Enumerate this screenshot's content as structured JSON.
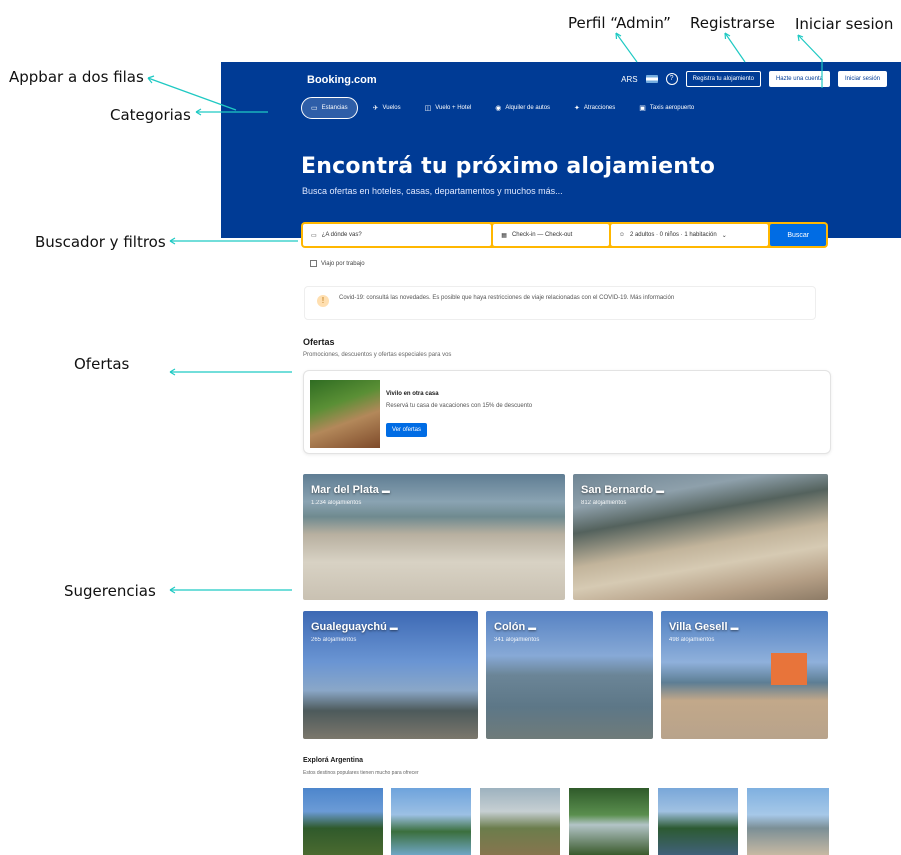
{
  "annotations": {
    "admin_profile": "Perfil “Admin”",
    "register": "Registrarse",
    "login": "Iniciar sesion",
    "appbar": "Appbar a dos filas",
    "categories": "Categorias",
    "search_filters": "Buscador y filtros",
    "offers": "Ofertas",
    "suggestions": "Sugerencias"
  },
  "appbar": {
    "logo": "Booking.com",
    "currency": "ARS",
    "admin_button": "Registra tu alojamiento",
    "register_button": "Hazte una cuenta",
    "login_button": "Iniciar sesión"
  },
  "categories": [
    {
      "label": "Estancias",
      "icon": "bed-icon"
    },
    {
      "label": "Vuelos",
      "icon": "plane-icon"
    },
    {
      "label": "Vuelo + Hotel",
      "icon": "suitcase-icon"
    },
    {
      "label": "Alquiler de autos",
      "icon": "car-icon"
    },
    {
      "label": "Atracciones",
      "icon": "ticket-icon"
    },
    {
      "label": "Taxis aeropuerto",
      "icon": "taxi-icon"
    }
  ],
  "hero": {
    "title": "Encontrá tu próximo alojamiento",
    "subtitle": "Busca ofertas en hoteles, casas, departamentos y muchos más..."
  },
  "search": {
    "destination_placeholder": "¿A dónde vas?",
    "dates": "Check-in — Check-out",
    "guests": "2 adultos · 0 niños · 1 habitación",
    "button": "Buscar",
    "checkbox_label": "Viajo por trabajo"
  },
  "notice": {
    "text": "Covid-19: consultá las novedades. Es posible que haya restricciones de viaje relacionadas con el COVID-19. Más información"
  },
  "offers": {
    "title": "Ofertas",
    "subtitle": "Promociones, descuentos y ofertas especiales para vos",
    "card_title": "Vivilo en otra casa",
    "card_desc": "Reservá tu casa de vacaciones con 15% de descuento",
    "card_button": "Ver ofertas"
  },
  "suggestions": [
    {
      "name": "Mar del Plata",
      "info": "1.234 alojamientos"
    },
    {
      "name": "San Bernardo",
      "info": "812 alojamientos"
    },
    {
      "name": "Gualeguaychú",
      "info": "265 alojamientos"
    },
    {
      "name": "Colón",
      "info": "341 alojamientos"
    },
    {
      "name": "Villa Gesell",
      "info": "498 alojamientos"
    }
  ],
  "explore": {
    "title": "Explorá Argentina",
    "subtitle": "Estos destinos populares tienen mucho para ofrecer"
  }
}
